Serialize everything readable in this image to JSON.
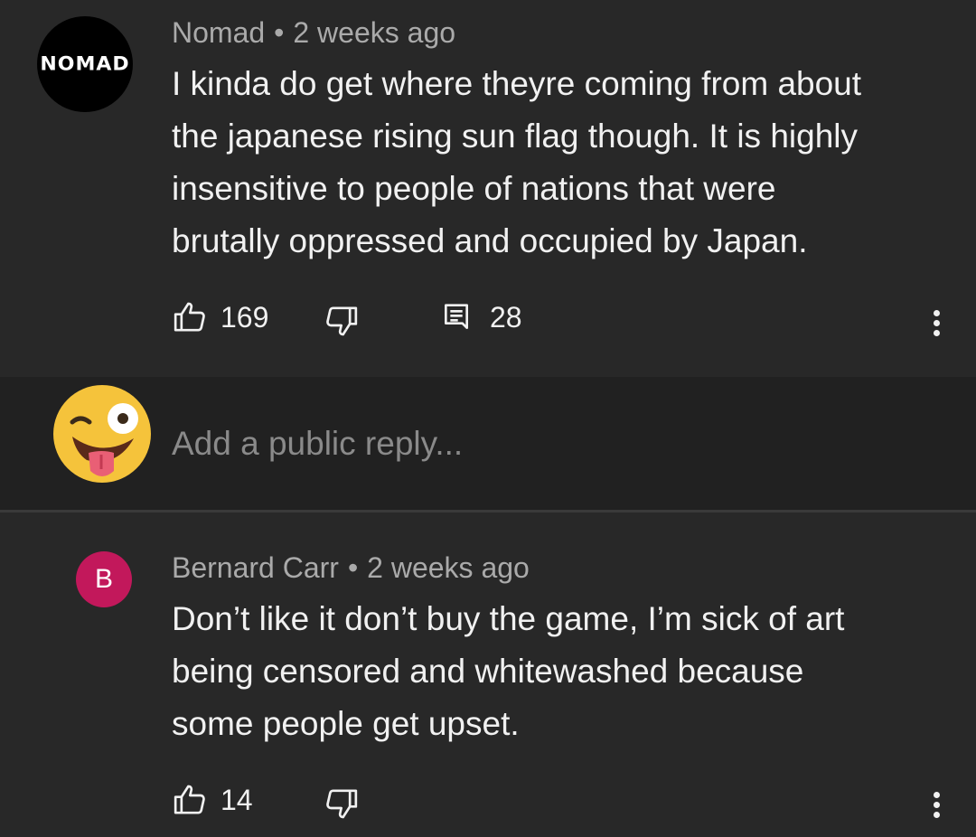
{
  "comments": [
    {
      "author": "Nomad",
      "avatar_text": "NOMAD",
      "time": "2 weeks ago",
      "lines": [
        "I kinda do get where theyre coming from about",
        "the japanese rising sun flag though. It is highly",
        "insensitive to people of nations that were",
        "brutally oppressed and occupied by Japan."
      ],
      "likes": "169",
      "replies": "28"
    },
    {
      "author": "Bernard Carr",
      "avatar_text": "B",
      "avatar_color": "#c2185b",
      "time": "2 weeks ago",
      "lines": [
        "Don’t like it don’t buy the game, I’m sick of art",
        "being censored and whitewashed because",
        "some people get upset."
      ],
      "likes": "14"
    }
  ],
  "reply_box": {
    "placeholder": "Add a public reply..."
  },
  "meta_separator": "•",
  "icons": [
    "like-icon",
    "dislike-icon",
    "reply-icon",
    "more-options-icon",
    "winking-tongue-emoji-avatar"
  ],
  "colors": {
    "background": "#282828",
    "reply_background": "#212121",
    "text": "#f1f1f1",
    "muted": "#aaaaaa"
  }
}
